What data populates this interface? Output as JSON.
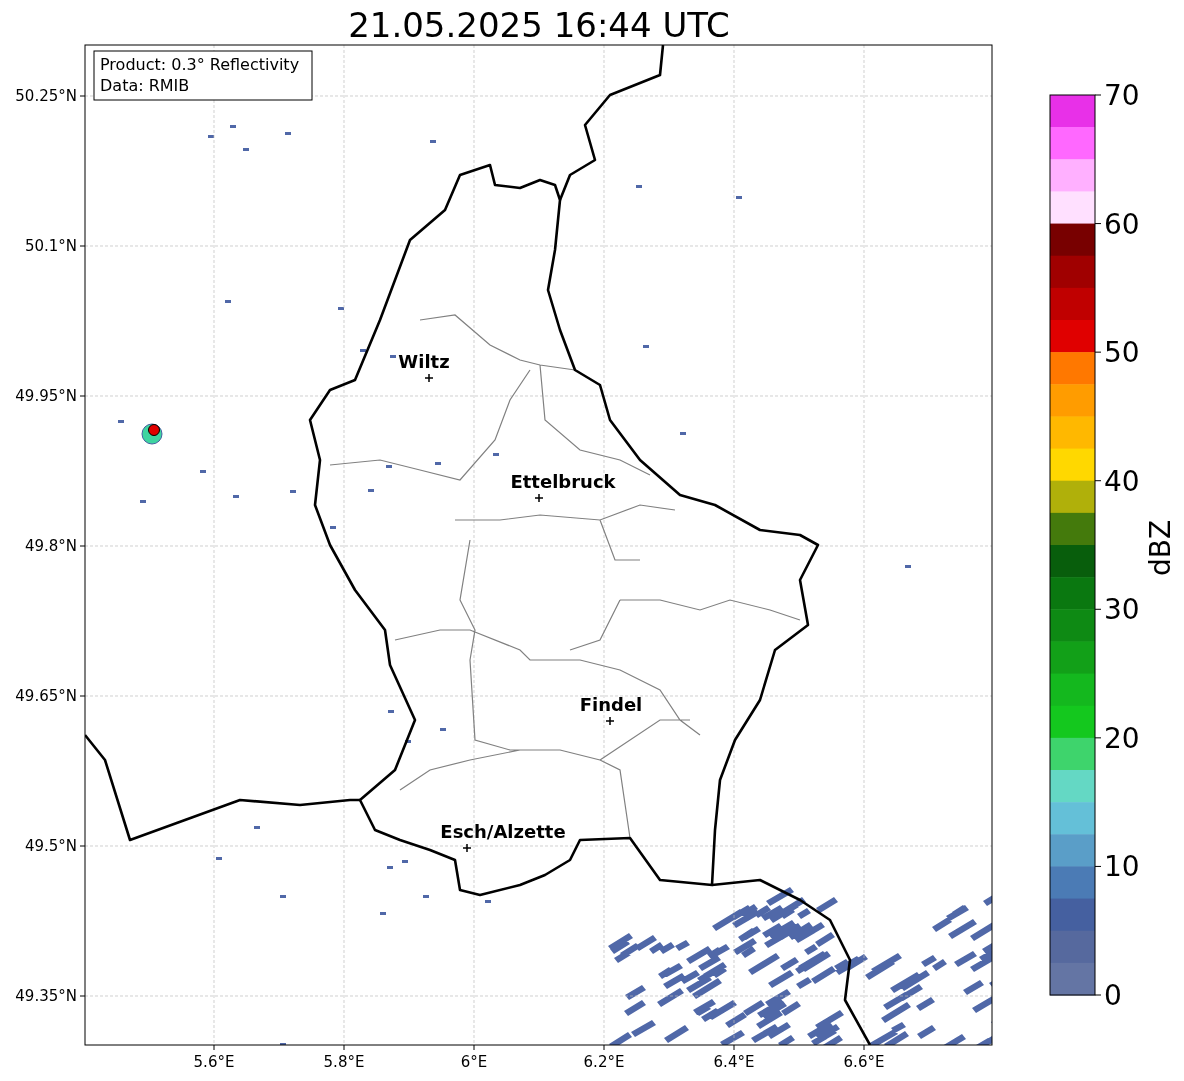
{
  "title": "21.05.2025 16:44 UTC",
  "info_box": [
    "Product: 0.3° Reflectivity",
    "Data: RMIB"
  ],
  "map": {
    "lat_ticks": [
      "50.25°N",
      "50.1°N",
      "49.95°N",
      "49.8°N",
      "49.65°N",
      "49.5°N",
      "49.35°N"
    ],
    "lon_ticks": [
      "5.6°E",
      "5.8°E",
      "6°E",
      "6.2°E",
      "6.4°E",
      "6.6°E"
    ],
    "cities": [
      {
        "name": "Wiltz"
      },
      {
        "name": "Ettelbruck"
      },
      {
        "name": "Findel"
      },
      {
        "name": "Esch/Alzette"
      }
    ]
  },
  "colorbar": {
    "label": "dBZ",
    "ticks": [
      "70",
      "60",
      "50",
      "40",
      "30",
      "20",
      "10",
      "0"
    ],
    "segments": [
      {
        "color": "#e830e8"
      },
      {
        "color": "#ff68ff"
      },
      {
        "color": "#ffb0ff"
      },
      {
        "color": "#ffe0ff"
      },
      {
        "color": "#780000"
      },
      {
        "color": "#a00000"
      },
      {
        "color": "#c00000"
      },
      {
        "color": "#e00000"
      },
      {
        "color": "#ff7800"
      },
      {
        "color": "#ff9c00"
      },
      {
        "color": "#ffb800"
      },
      {
        "color": "#ffd800"
      },
      {
        "color": "#b0b00a"
      },
      {
        "color": "#447a0c"
      },
      {
        "color": "#085e0c"
      },
      {
        "color": "#0a7810"
      },
      {
        "color": "#0e8a14"
      },
      {
        "color": "#12a018"
      },
      {
        "color": "#14b81e"
      },
      {
        "color": "#14c81e"
      },
      {
        "color": "#3ed46c"
      },
      {
        "color": "#64d8c4"
      },
      {
        "color": "#64c0d8"
      },
      {
        "color": "#5a9ec8"
      },
      {
        "color": "#4b7bb5"
      },
      {
        "color": "#4560a0"
      },
      {
        "color": "#56699e"
      },
      {
        "color": "#6475a4"
      }
    ]
  }
}
